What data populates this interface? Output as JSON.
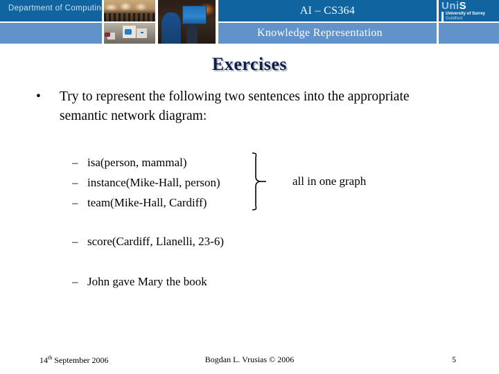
{
  "header": {
    "department": "Department of Computing",
    "course_title": "AI – CS364",
    "subject_title": "Knowledge Representation",
    "logo": {
      "word_uni": "Uni",
      "word_s": "S",
      "university": "University of Surrey",
      "city": "Guildford"
    },
    "colors": {
      "band_dark": "#1065a0",
      "band_light": "#6192ca"
    },
    "photos": [
      {
        "name": "lecture-hall-photo"
      },
      {
        "name": "computer-lab-photo"
      },
      {
        "name": "students-at-laptop-photo"
      }
    ]
  },
  "slide": {
    "title": "Exercises",
    "title_color": "#0d1f4e",
    "main_bullet": {
      "marker": "•",
      "text": "Try to represent the following two sentences into the appropriate semantic network diagram:"
    },
    "sub_items": [
      {
        "marker": "–",
        "text": "isa(person, mammal)"
      },
      {
        "marker": "–",
        "text": "instance(Mike-Hall, person)"
      },
      {
        "marker": "–",
        "text": "team(Mike-Hall, Cardiff)"
      },
      {
        "marker": "–",
        "text": "score(Cardiff, Llanelli, 23-6)"
      },
      {
        "marker": "–",
        "text": "John gave Mary the book"
      }
    ],
    "group_note": "all in one graph"
  },
  "footer": {
    "date_number": "14",
    "date_suffix": "th",
    "date_rest": " September 2006",
    "author": "Bogdan L. Vrusias © 2006",
    "page_number": "5"
  }
}
